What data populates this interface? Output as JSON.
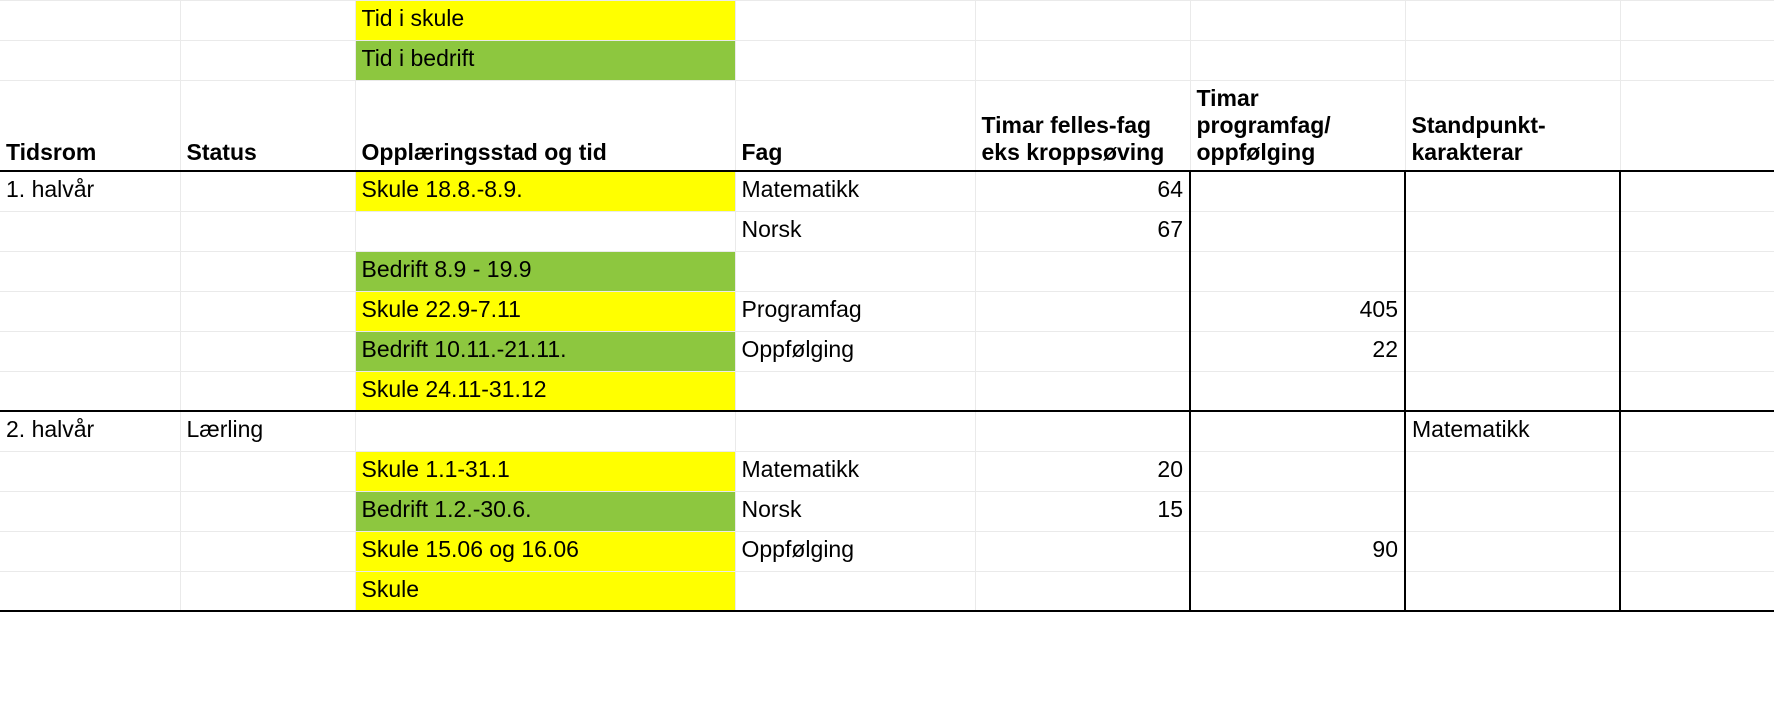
{
  "legend": {
    "skule": "Tid i skule",
    "bedrift": "Tid i bedrift"
  },
  "headers": {
    "tidsrom": "Tidsrom",
    "status": "Status",
    "opplaering": "Opplæringsstad og tid",
    "fag": "Fag",
    "timar_felles": "Timar felles-fag eks kroppsøving",
    "timar_program": "Timar programfag/ oppfølging",
    "standpunkt": "Standpunkt-karakterar"
  },
  "rows": [
    {
      "tidsrom": "1. halvår",
      "status": "",
      "sted": "Skule 18.8.-8.9.",
      "sted_color": "yellow",
      "fag": "Matematikk",
      "felles": "64",
      "program": "",
      "standpunkt": "",
      "section": "top"
    },
    {
      "tidsrom": "",
      "status": "",
      "sted": "",
      "sted_color": "",
      "fag": "Norsk",
      "felles": "67",
      "program": "",
      "standpunkt": "",
      "section": ""
    },
    {
      "tidsrom": "",
      "status": "",
      "sted": "Bedrift 8.9 - 19.9",
      "sted_color": "green",
      "fag": "",
      "felles": "",
      "program": "",
      "standpunkt": "",
      "section": ""
    },
    {
      "tidsrom": "",
      "status": "",
      "sted": "Skule 22.9-7.11",
      "sted_color": "yellow",
      "fag": "Programfag",
      "felles": "",
      "program": "405",
      "standpunkt": "",
      "section": ""
    },
    {
      "tidsrom": "",
      "status": "",
      "sted": "Bedrift 10.11.-21.11.",
      "sted_color": "green",
      "fag": "Oppfølging",
      "felles": "",
      "program": "22",
      "standpunkt": "",
      "section": ""
    },
    {
      "tidsrom": "",
      "status": "",
      "sted": "Skule 24.11-31.12",
      "sted_color": "yellow",
      "fag": "",
      "felles": "",
      "program": "",
      "standpunkt": "",
      "section": "bottom"
    },
    {
      "tidsrom": "2. halvår",
      "status": "Lærling",
      "sted": "",
      "sted_color": "",
      "fag": "",
      "felles": "",
      "program": "",
      "standpunkt": "Matematikk",
      "section": "top"
    },
    {
      "tidsrom": "",
      "status": "",
      "sted": "Skule 1.1-31.1",
      "sted_color": "yellow",
      "fag": "Matematikk",
      "felles": "20",
      "program": "",
      "standpunkt": "",
      "section": ""
    },
    {
      "tidsrom": "",
      "status": "",
      "sted": "Bedrift 1.2.-30.6.",
      "sted_color": "green",
      "fag": "Norsk",
      "felles": "15",
      "program": "",
      "standpunkt": "",
      "section": ""
    },
    {
      "tidsrom": "",
      "status": "",
      "sted": "Skule 15.06 og 16.06",
      "sted_color": "yellow",
      "fag": "Oppfølging",
      "felles": "",
      "program": "90",
      "standpunkt": "",
      "section": ""
    },
    {
      "tidsrom": "",
      "status": "",
      "sted": "Skule",
      "sted_color": "yellow",
      "fag": "",
      "felles": "",
      "program": "",
      "standpunkt": "",
      "section": "bottom"
    }
  ]
}
